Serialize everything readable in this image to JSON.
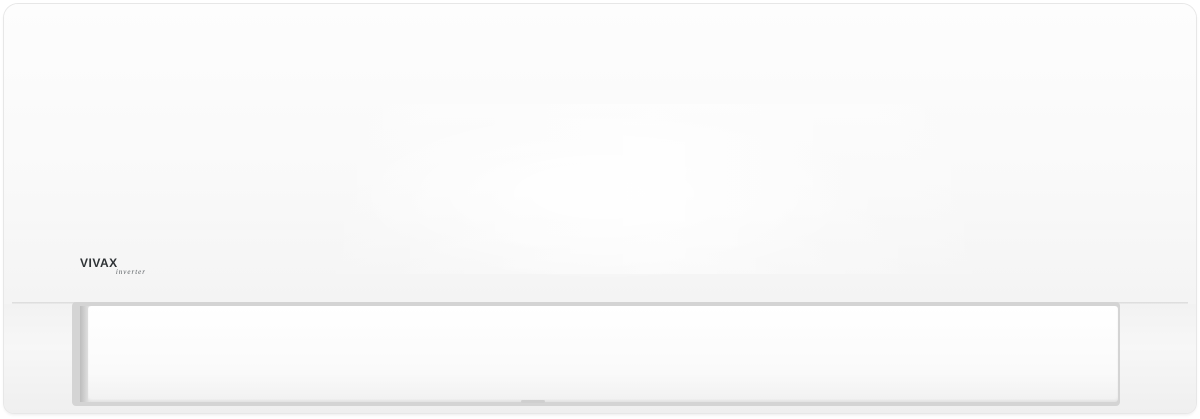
{
  "product": {
    "brand": "VIVAX",
    "subtitle": "inverter"
  },
  "colors": {
    "background": "#ffffff",
    "body": "#f8f8f8",
    "logo_text": "#2f3336"
  }
}
